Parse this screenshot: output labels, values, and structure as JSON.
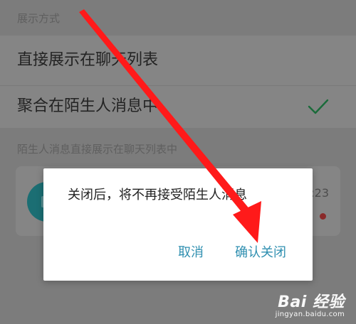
{
  "settings": {
    "display_mode_header": "展示方式",
    "option_direct": "直接展示在聊天列表",
    "option_aggregate": "聚合在陌生人消息中",
    "selected_check_icon": "check-icon",
    "preview_header": "陌生人消息直接展示在聊天列表中",
    "preview_time": ":23"
  },
  "dialog": {
    "message": "关闭后，将不再接受陌生人消息",
    "cancel_label": "取消",
    "confirm_label": "确认关闭"
  },
  "watermark": {
    "logo_text": "Bai 经验",
    "url": "jingyan.baidu.com"
  },
  "colors": {
    "accent": "#2f8fb0",
    "check": "#1a6b3a",
    "arrow": "#ff1a1a",
    "overlay": "#7c7c7c"
  }
}
